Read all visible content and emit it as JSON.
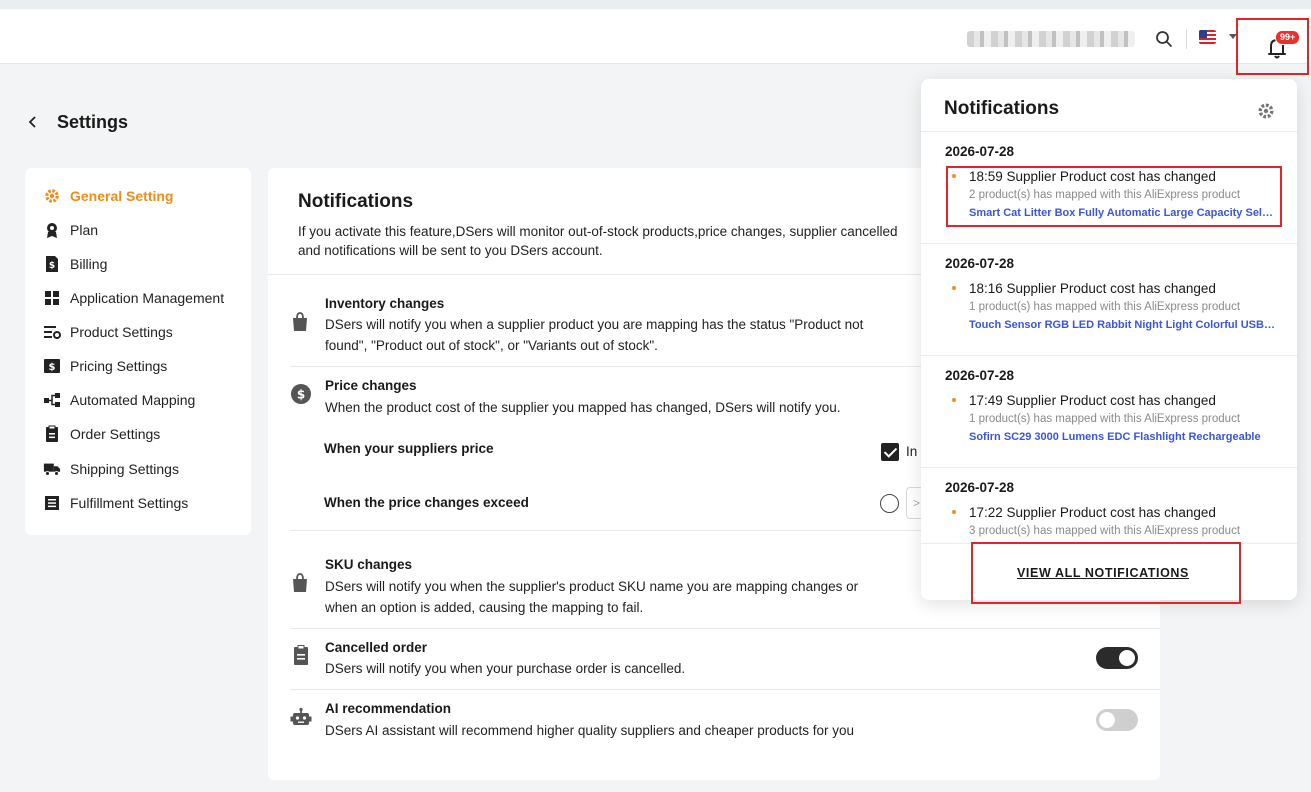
{
  "topbar": {
    "notification_badge": "99+"
  },
  "settings": {
    "title": "Settings"
  },
  "sidebar": {
    "items": [
      {
        "label": "General Setting",
        "icon": "gear-icon",
        "active": true
      },
      {
        "label": "Plan",
        "icon": "award-icon",
        "active": false
      },
      {
        "label": "Billing",
        "icon": "billing-icon",
        "active": false
      },
      {
        "label": "Application Management",
        "icon": "apps-grid-icon",
        "active": false
      },
      {
        "label": "Product Settings",
        "icon": "product-settings-icon",
        "active": false
      },
      {
        "label": "Pricing Settings",
        "icon": "dollar-icon",
        "active": false
      },
      {
        "label": "Automated Mapping",
        "icon": "mapping-icon",
        "active": false
      },
      {
        "label": "Order Settings",
        "icon": "clipboard-icon",
        "active": false
      },
      {
        "label": "Shipping Settings",
        "icon": "truck-icon",
        "active": false
      },
      {
        "label": "Fulfillment Settings",
        "icon": "list-icon",
        "active": false
      }
    ]
  },
  "main": {
    "title": "Notifications",
    "desc_line1": "If you activate this feature,DSers will monitor out-of-stock products,price changes, supplier cancelled",
    "desc_line2": "and notifications will be sent to you DSers account.",
    "inventory": {
      "title": "Inventory changes",
      "text": "DSers will notify you when a supplier product you are mapping has the status \"Product not found\", \"Product out of stock\", or \"Variants out of stock\"."
    },
    "price": {
      "title": "Price changes",
      "text": "When the product cost of the supplier you mapped has changed, DSers will notify you.",
      "sub1_label": "When your suppliers price",
      "sub1_option": "In",
      "sub1_checked": true,
      "sub2_label": "When the price changes exceed",
      "sub2_input": ">"
    },
    "sku": {
      "title": "SKU changes",
      "text": "DSers will notify you when the supplier's product SKU name you are mapping changes or when an option is added, causing the mapping to fail."
    },
    "cancelled": {
      "title": "Cancelled order",
      "text": "DSers will notify you when your purchase order is cancelled.",
      "enabled": true
    },
    "ai": {
      "title": "AI recommendation",
      "text": "DSers AI assistant will recommend higher quality suppliers and cheaper products for you",
      "enabled": false
    }
  },
  "notifications": {
    "title": "Notifications",
    "items": [
      {
        "date": "2026-07-28",
        "headline": "18:59 Supplier Product cost has changed",
        "mapped": "2 product(s) has mapped with this AliExpress product",
        "product": "Smart Cat Litter Box Fully Automatic Large Capacity Self-Cleaning"
      },
      {
        "date": "2026-07-28",
        "headline": "18:16 Supplier Product cost has changed",
        "mapped": "1 product(s) has mapped with this AliExpress product",
        "product": "Touch Sensor RGB LED Rabbit Night Light Colorful USB Rechargeable"
      },
      {
        "date": "2026-07-28",
        "headline": "17:49 Supplier Product cost has changed",
        "mapped": "1 product(s) has mapped with this AliExpress product",
        "product": "Sofirn SC29 3000 Lumens EDC Flashlight Rechargeable"
      },
      {
        "date": "2026-07-28",
        "headline": "17:22 Supplier Product cost has changed",
        "mapped": "3 product(s) has mapped with this AliExpress product",
        "product": ""
      }
    ],
    "view_all": "VIEW ALL NOTIFICATIONS"
  },
  "colors": {
    "accent": "#f08c1a",
    "link": "#3a55e0",
    "highlight": "#e0262b",
    "badge": "#e8312f"
  }
}
